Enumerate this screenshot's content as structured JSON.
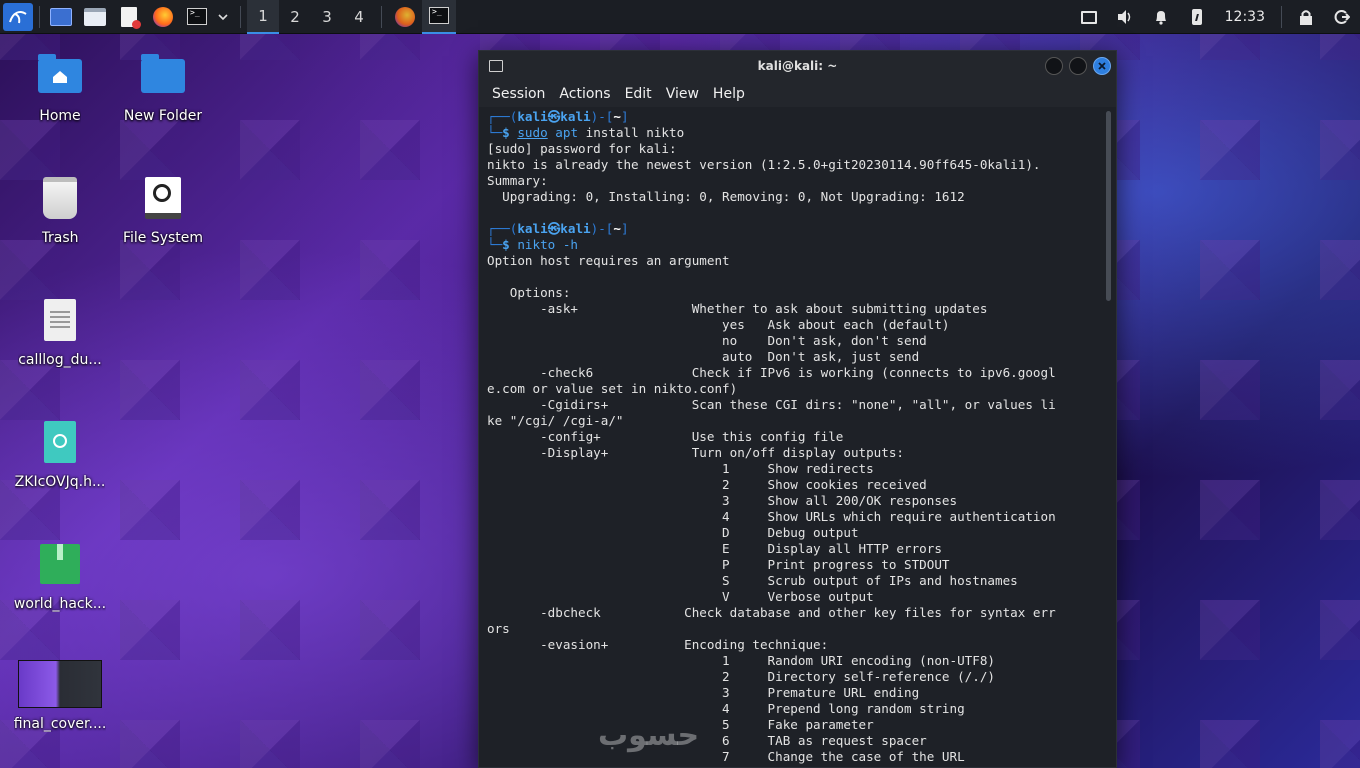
{
  "panel": {
    "workspaces": [
      "1",
      "2",
      "3",
      "4"
    ],
    "clock": "12:33",
    "colors": {
      "panel_bg": "#1b1e24",
      "accent": "#3a8ee6"
    }
  },
  "desktop": {
    "icons": [
      {
        "label": "Home",
        "icon": "home-folder-icon"
      },
      {
        "label": "New Folder",
        "icon": "folder-icon"
      },
      {
        "label": "Trash",
        "icon": "trash-icon"
      },
      {
        "label": "File System",
        "icon": "drive-icon"
      },
      {
        "label": "calllog_du...",
        "icon": "text-file-icon"
      },
      {
        "label": "ZKIcOVJq.h...",
        "icon": "html-file-icon"
      },
      {
        "label": "world_hack...",
        "icon": "archive-icon"
      },
      {
        "label": "final_cover....",
        "icon": "image-thumbnail-icon"
      }
    ]
  },
  "terminal": {
    "title": "kali@kali: ~",
    "menu": [
      "Session",
      "Actions",
      "Edit",
      "View",
      "Help"
    ],
    "prompt": {
      "user": "kali",
      "at": "㉿",
      "host": "kali",
      "cwd": "~",
      "cmd1_sudo": "sudo",
      "cmd1_apt": "apt",
      "cmd1_rest": " install nikto",
      "cmd2": "nikto -h"
    },
    "lines": [
      "[sudo] password for kali:",
      "nikto is already the newest version (1:2.5.0+git20230114.90ff645-0kali1).",
      "Summary:",
      "  Upgrading: 0, Installing: 0, Removing: 0, Not Upgrading: 1612",
      "",
      "Option host requires an argument",
      "",
      "   Options:",
      "       -ask+               Whether to ask about submitting updates",
      "                               yes   Ask about each (default)",
      "                               no    Don't ask, don't send",
      "                               auto  Don't ask, just send",
      "       -check6             Check if IPv6 is working (connects to ipv6.googl",
      "e.com or value set in nikto.conf)",
      "       -Cgidirs+           Scan these CGI dirs: \"none\", \"all\", or values li",
      "ke \"/cgi/ /cgi-a/\"",
      "       -config+            Use this config file",
      "       -Display+           Turn on/off display outputs:",
      "                               1     Show redirects",
      "                               2     Show cookies received",
      "                               3     Show all 200/OK responses",
      "                               4     Show URLs which require authentication",
      "                               D     Debug output",
      "                               E     Display all HTTP errors",
      "                               P     Print progress to STDOUT",
      "                               S     Scrub output of IPs and hostnames",
      "                               V     Verbose output",
      "       -dbcheck           Check database and other key files for syntax err",
      "ors",
      "       -evasion+          Encoding technique:",
      "                               1     Random URI encoding (non-UTF8)",
      "                               2     Directory self-reference (/./)",
      "                               3     Premature URL ending",
      "                               4     Prepend long random string",
      "                               5     Fake parameter",
      "                               6     TAB as request spacer",
      "                               7     Change the case of the URL"
    ]
  },
  "watermark": "حسوب"
}
